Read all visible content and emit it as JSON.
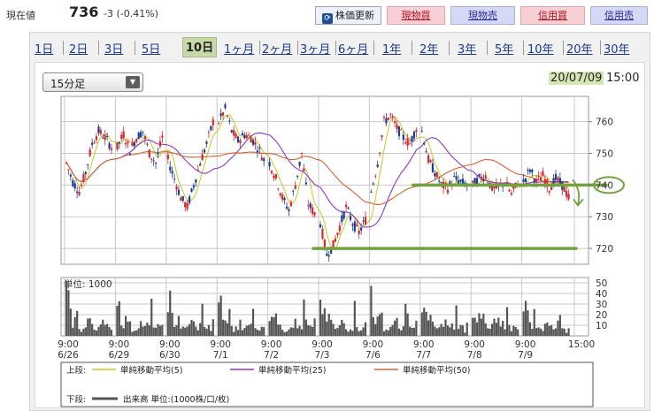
{
  "header": {
    "price_label": "現在値",
    "price_value": "736",
    "price_change": "-3 (-0.41%)",
    "update_button": "株価更新",
    "cash_buy": "現物買",
    "cash_sell": "現物売",
    "margin_buy": "信用買",
    "margin_sell": "信用売"
  },
  "colors": {
    "up": "#d8272a",
    "down": "#1c3f8f",
    "ma5": "#c8c824",
    "ma25": "#8e35c9",
    "ma50": "#d8622e",
    "volume": "#555555",
    "annotation": "#72a23e",
    "grid": "#c8c8c8"
  },
  "tabs": [
    "1日",
    "2日",
    "3日",
    "5日",
    "10日",
    "1ヶ月",
    "2ヶ月",
    "3ヶ月",
    "6ヶ月",
    "1年",
    "2年",
    "3年",
    "5年",
    "10年",
    "20年",
    "30年"
  ],
  "active_tab": "10日",
  "interval_select": "15分足",
  "datetime": {
    "date": "20/07/09",
    "time": "15:00"
  },
  "chart_data": {
    "type": "candlestick",
    "interval": "15分足",
    "y_ticks": [
      720,
      730,
      740,
      750,
      760
    ],
    "ylim": [
      715,
      768
    ],
    "volume_unit_label": "単位: 1000",
    "volume_ticks": [
      10,
      20,
      30,
      40,
      50
    ],
    "volume_ylim": [
      0,
      55
    ],
    "x_ticks": [
      {
        "time": "9:00",
        "date": "6/26"
      },
      {
        "time": "9:00",
        "date": "6/29"
      },
      {
        "time": "9:00",
        "date": "6/30"
      },
      {
        "time": "9:00",
        "date": "7/1"
      },
      {
        "time": "9:00",
        "date": "7/2"
      },
      {
        "time": "9:00",
        "date": "7/3"
      },
      {
        "time": "9:00",
        "date": "7/6"
      },
      {
        "time": "9:00",
        "date": "7/7"
      },
      {
        "time": "9:00",
        "date": "7/8"
      },
      {
        "time": "9:00",
        "date": "7/9"
      },
      {
        "time": "15:00",
        "date": ""
      }
    ],
    "days": [
      {
        "date": "6/26",
        "path": [
          747,
          741,
          738,
          744,
          753,
          757,
          755,
          752
        ]
      },
      {
        "date": "6/29",
        "path": [
          752,
          756,
          751,
          755,
          757,
          750,
          747,
          755
        ]
      },
      {
        "date": "6/30",
        "path": [
          748,
          742,
          736,
          733,
          740,
          747,
          753,
          760
        ]
      },
      {
        "date": "7/1",
        "path": [
          760,
          764,
          757,
          754,
          756,
          755,
          752,
          748
        ]
      },
      {
        "date": "7/2",
        "path": [
          747,
          742,
          736,
          732,
          740,
          750,
          734,
          731
        ]
      },
      {
        "date": "7/3",
        "path": [
          728,
          718,
          721,
          727,
          733,
          728,
          725,
          729
        ]
      },
      {
        "date": "7/6",
        "path": [
          738,
          747,
          760,
          762,
          758,
          755,
          753,
          758
        ]
      },
      {
        "date": "7/7",
        "path": [
          757,
          748,
          744,
          740,
          739,
          742,
          741,
          740
        ]
      },
      {
        "date": "7/8",
        "path": [
          740,
          742,
          743,
          739,
          739,
          741,
          737,
          741
        ]
      },
      {
        "date": "7/9",
        "path": [
          741,
          745,
          741,
          743,
          739,
          742,
          740,
          736
        ]
      }
    ],
    "volume_profile": [
      38,
      22,
      18,
      24,
      12,
      8,
      10,
      20,
      15,
      9,
      12,
      30,
      18,
      10,
      8,
      14
    ],
    "annotation_levels": [
      740,
      720
    ],
    "annotation_level_label": "740",
    "legend": {
      "upper_label": "上段:",
      "lower_label": "下段:",
      "ma5": "単純移動平均(5)",
      "ma25": "単純移動平均(25)",
      "ma50": "単純移動平均(50)",
      "volume": "出来高 単位:(1000株/口/枚)"
    }
  }
}
